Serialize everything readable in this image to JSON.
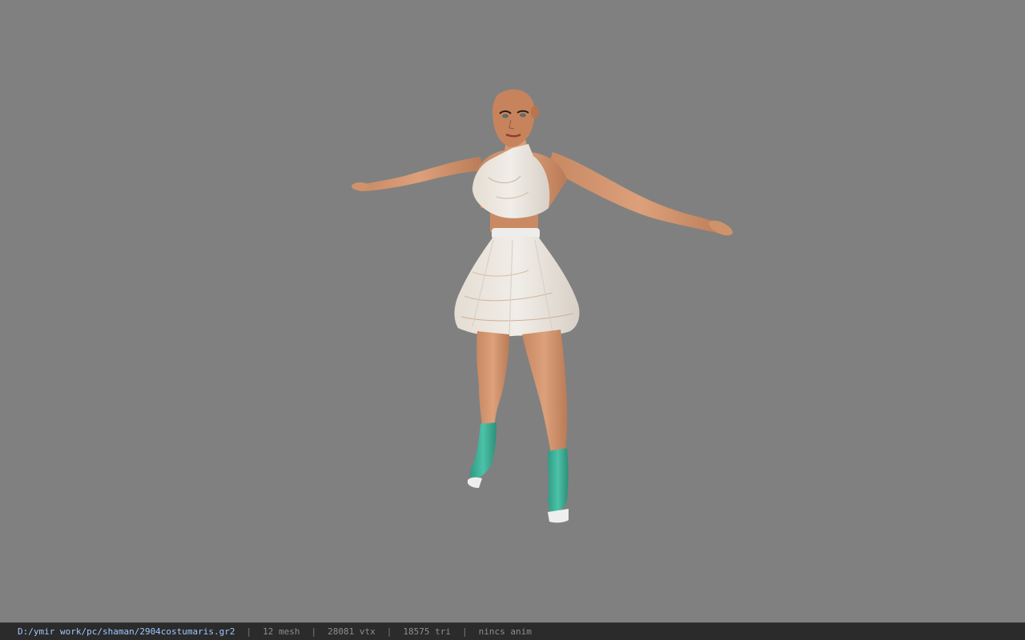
{
  "viewport": {
    "background_color": "#808080",
    "model": {
      "skin_color": "#d3976e",
      "dress_color": "#ebe6df",
      "boot_color": "#3fb39a",
      "sole_color": "#eeeeee"
    }
  },
  "status_bar": {
    "file_path": "D:/ymir work/pc/shaman/2904costumaris.gr2",
    "separator": "|",
    "mesh_count": "12 mesh",
    "vertex_count": "28081 vtx",
    "triangle_count": "18575 tri",
    "anim_status": "nincs anim"
  }
}
